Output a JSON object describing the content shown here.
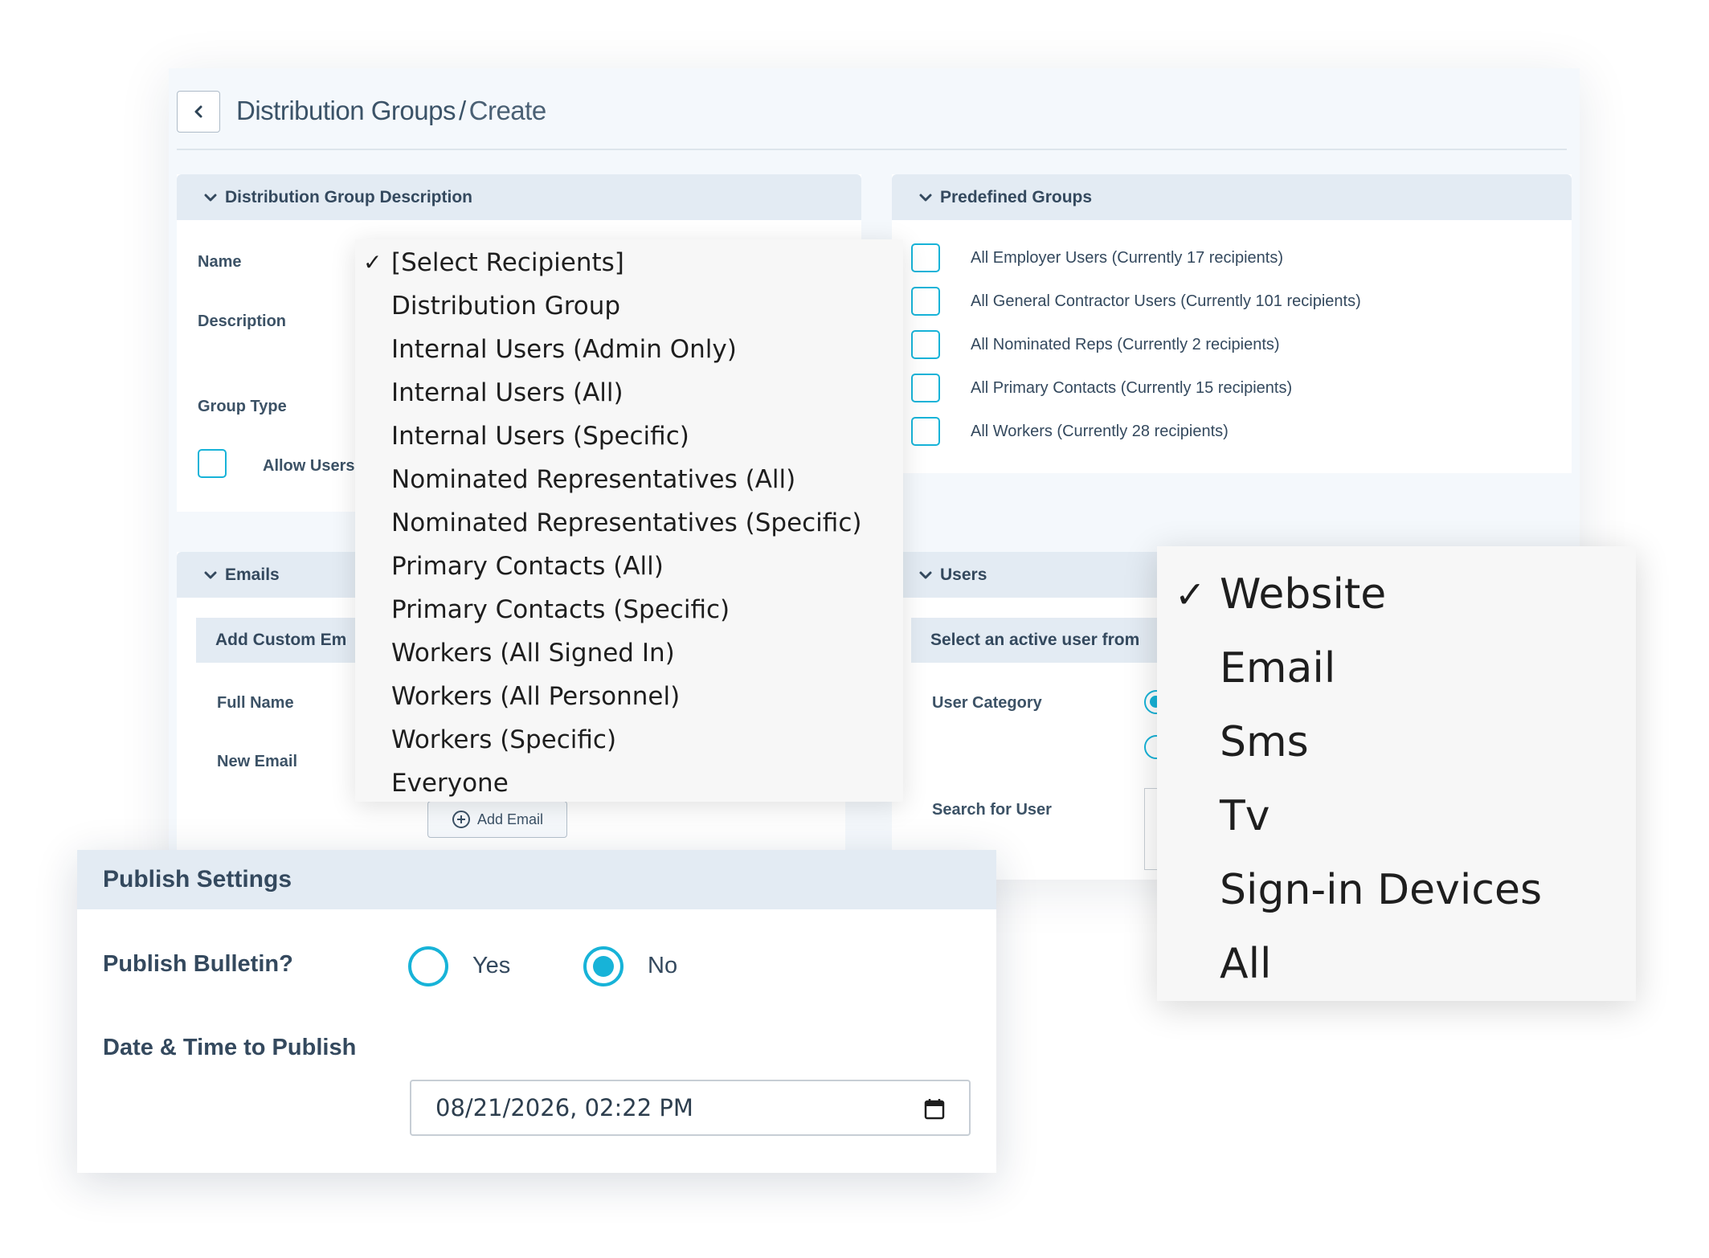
{
  "header": {
    "breadcrumb_root": "Distribution Groups",
    "breadcrumb_sep": "/",
    "breadcrumb_current": "Create"
  },
  "description_panel": {
    "title": "Distribution Group Description",
    "name_label": "Name",
    "description_label": "Description",
    "group_type_label": "Group Type",
    "allow_users_label": "Allow Users"
  },
  "predefined_groups": {
    "title": "Predefined Groups",
    "items": [
      {
        "label": "All Employer Users (Currently 17 recipients)"
      },
      {
        "label": "All General Contractor Users (Currently 101 recipients)"
      },
      {
        "label": "All Nominated Reps (Currently 2 recipients)"
      },
      {
        "label": "All Primary Contacts (Currently 15 recipients)"
      },
      {
        "label": "All Workers (Currently 28 recipients)"
      }
    ]
  },
  "emails_panel": {
    "title": "Emails",
    "subheader": "Add Custom Em",
    "full_name_label": "Full Name",
    "new_email_label": "New Email",
    "add_email_label": "Add Email"
  },
  "users_panel": {
    "title": "Users",
    "subheader": "Select an active user from",
    "user_category_label": "User Category",
    "search_label": "Search for User"
  },
  "recipient_dropdown": {
    "items": [
      {
        "label": "[Select Recipients]",
        "selected": true
      },
      {
        "label": "Distribution Group"
      },
      {
        "label": "Internal Users (Admin Only)"
      },
      {
        "label": "Internal Users (All)"
      },
      {
        "label": "Internal Users (Specific)"
      },
      {
        "label": "Nominated Representatives (All)"
      },
      {
        "label": "Nominated Representatives (Specific)"
      },
      {
        "label": "Primary Contacts (All)"
      },
      {
        "label": "Primary Contacts (Specific)"
      },
      {
        "label": "Workers (All Signed In)"
      },
      {
        "label": "Workers (All Personnel)"
      },
      {
        "label": "Workers (Specific)"
      },
      {
        "label": "Everyone"
      }
    ]
  },
  "channel_dropdown": {
    "items": [
      {
        "label": "Website",
        "selected": true
      },
      {
        "label": "Email"
      },
      {
        "label": "Sms"
      },
      {
        "label": "Tv"
      },
      {
        "label": "Sign-in Devices"
      },
      {
        "label": "All"
      }
    ]
  },
  "publish_settings": {
    "title": "Publish Settings",
    "bulletin_label": "Publish Bulletin?",
    "yes_label": "Yes",
    "no_label": "No",
    "selected": "No",
    "datetime_label": "Date & Time to Publish",
    "datetime_value": "08/21/2026, 02:22 PM"
  },
  "colors": {
    "accent": "#17b3d8",
    "header_bg": "#e3ebf3",
    "text": "#34495e"
  },
  "icons": {
    "back": "chevron-left-icon",
    "collapse": "chevron-down-icon",
    "add": "plus-circle-icon",
    "calendar": "calendar-icon",
    "check": "checkmark-icon"
  }
}
